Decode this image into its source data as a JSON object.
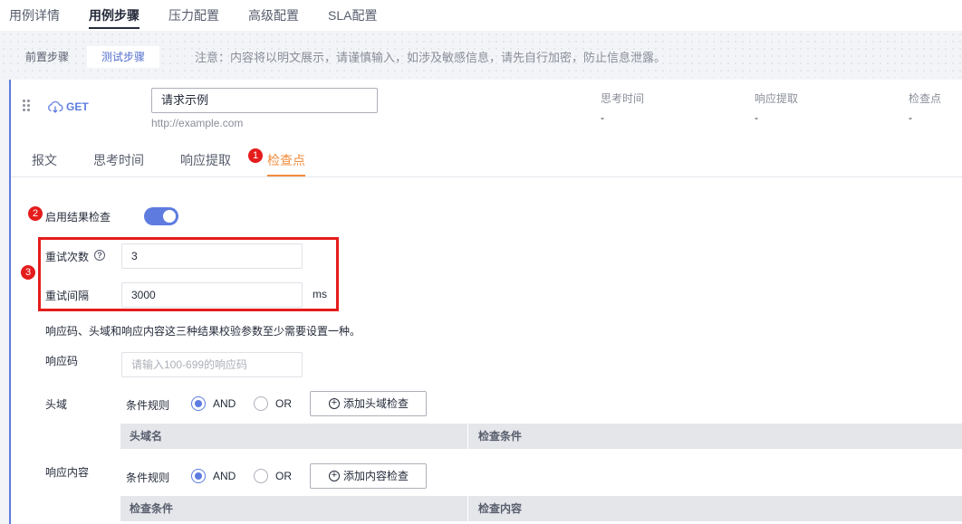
{
  "top_tabs": [
    "用例详情",
    "用例步骤",
    "压力配置",
    "高级配置",
    "SLA配置"
  ],
  "sub_tabs": [
    "前置步骤",
    "测试步骤"
  ],
  "notice": "注意：内容将以明文展示，请谨慎输入，如涉及敏感信息，请先自行加密，防止信息泄露。",
  "step": {
    "method": "GET",
    "name": "请求示例",
    "url": "http://example.com",
    "stats": [
      {
        "label": "思考时间",
        "value": "-"
      },
      {
        "label": "响应提取",
        "value": "-"
      },
      {
        "label": "检查点",
        "value": "-"
      }
    ]
  },
  "inner_tabs": [
    "报文",
    "思考时间",
    "响应提取",
    "检查点"
  ],
  "markers": [
    "1",
    "2",
    "3"
  ],
  "check": {
    "enable_label": "启用结果检查",
    "enabled": true,
    "retry_count_label": "重试次数",
    "retry_count": "3",
    "retry_interval_label": "重试间隔",
    "retry_interval": "3000",
    "unit": "ms",
    "hint": "响应码、头域和响应内容这三种结果校验参数至少需要设置一种。",
    "code_label": "响应码",
    "code_placeholder": "请输入100-699的响应码",
    "header_label": "头域",
    "content_label": "响应内容",
    "rule_label": "条件规则",
    "and_label": "AND",
    "or_label": "OR",
    "add_header_btn": "添加头域检查",
    "add_content_btn": "添加内容检查",
    "header_cols": [
      "头域名",
      "检查条件"
    ],
    "content_cols": [
      "检查条件",
      "检查内容"
    ]
  },
  "colors": {
    "accent": "#5e7ce0",
    "active_tab": "#f28c3c",
    "marker": "#e51c1c"
  }
}
